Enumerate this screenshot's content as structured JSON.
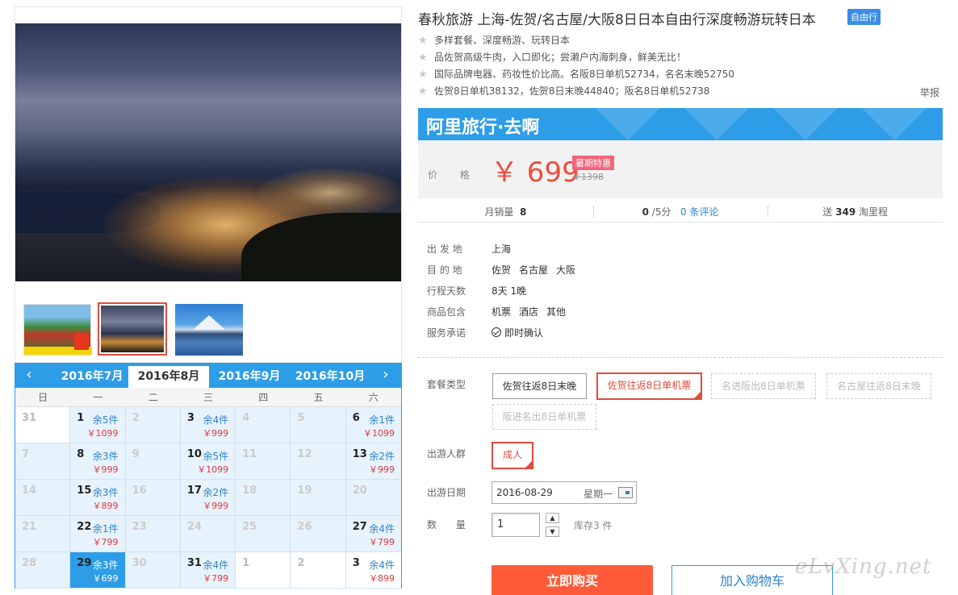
{
  "product": {
    "title": "春秋旅游 上海-佐贺/名古屋/大阪8日日本自由行深度畅游玩转日本",
    "tag": "自由行",
    "features": [
      "多样套餐、深度畅游、玩转日本",
      "品佐贺高级牛肉，入口即化；尝濑户内海刺身，鲜美无比！",
      "国际品牌电器、药妆性价比高。名阪8日单机52734，名名末晚52750",
      "佐贺8日单机38132，佐贺8日末晚44840；阪名8日单机52738"
    ],
    "report": "举报"
  },
  "price_box": {
    "brand": "阿里旅行·去啊",
    "price_label": "价 格",
    "price": "￥ 699",
    "promo": "暑期特惠",
    "original_price": "￥1398"
  },
  "stats": {
    "sales_label": "月销量",
    "sales_value": "8",
    "rating_value": "0",
    "rating_suffix": "/5分",
    "reviews_link": "0 条评论",
    "points_prefix": "送",
    "points_value": "349",
    "points_suffix": "淘里程"
  },
  "info": [
    {
      "key": "出 发 地",
      "values": [
        "上海"
      ]
    },
    {
      "key": "目 的 地",
      "values": [
        "佐贺",
        "名古屋",
        "大阪"
      ]
    },
    {
      "key": "行程天数",
      "values": [
        "8天 1晚"
      ]
    },
    {
      "key": "商品包含",
      "values": [
        "机票",
        "酒店",
        "其他"
      ]
    },
    {
      "key": "服务承诺",
      "values": [
        "即时确认"
      ]
    }
  ],
  "options": {
    "package_label": "套餐类型",
    "packages": [
      "佐贺往返8日末晚",
      "佐贺往返8日单机票",
      "名进阪出8日单机票",
      "名古屋往返8日末晚",
      "阪进名出8日单机票"
    ],
    "traveler_label": "出游人群",
    "traveler": "成人",
    "date_label": "出游日期",
    "date_value": "2016-08-29",
    "weekday": "星期一",
    "qty_label": "数 量",
    "qty_value": "1",
    "stock_text": "库存3 件"
  },
  "buttons": {
    "buy": "立即购买",
    "cart": "加入购物车"
  },
  "calendar": {
    "tabs": [
      "2016年7月",
      "2016年8月",
      "2016年9月",
      "2016年10月"
    ],
    "active_tab": "2016年8月",
    "weekdays": [
      "日",
      "一",
      "二",
      "三",
      "四",
      "五",
      "六"
    ],
    "cells": [
      {
        "d": "31",
        "out": true
      },
      {
        "d": "1",
        "s": "余5件",
        "p": "￥1099"
      },
      {
        "d": "2"
      },
      {
        "d": "3",
        "s": "余4件",
        "p": "￥999"
      },
      {
        "d": "4"
      },
      {
        "d": "5"
      },
      {
        "d": "6",
        "s": "余1件",
        "p": "￥1099"
      },
      {
        "d": "7"
      },
      {
        "d": "8",
        "s": "余3件",
        "p": "￥999"
      },
      {
        "d": "9"
      },
      {
        "d": "10",
        "s": "余5件",
        "p": "￥1099"
      },
      {
        "d": "11"
      },
      {
        "d": "12"
      },
      {
        "d": "13",
        "s": "余2件",
        "p": "￥999"
      },
      {
        "d": "14"
      },
      {
        "d": "15",
        "s": "余3件",
        "p": "￥899"
      },
      {
        "d": "16"
      },
      {
        "d": "17",
        "s": "余2件",
        "p": "￥999"
      },
      {
        "d": "18"
      },
      {
        "d": "19"
      },
      {
        "d": "20"
      },
      {
        "d": "21"
      },
      {
        "d": "22",
        "s": "余1件",
        "p": "￥799"
      },
      {
        "d": "23"
      },
      {
        "d": "24"
      },
      {
        "d": "25"
      },
      {
        "d": "26"
      },
      {
        "d": "27",
        "s": "余4件",
        "p": "￥799"
      },
      {
        "d": "28"
      },
      {
        "d": "29",
        "s": "余3件",
        "p": "￥699",
        "sel": true
      },
      {
        "d": "30"
      },
      {
        "d": "31",
        "s": "余4件",
        "p": "￥799"
      },
      {
        "d": "1",
        "out": true
      },
      {
        "d": "2",
        "out": true
      },
      {
        "d": "3",
        "s": "余4件",
        "p": "￥899",
        "out": true
      }
    ]
  },
  "watermark": "eLvXing.net",
  "colors": {
    "accent": "#2d9de8",
    "price": "#f04b3b",
    "buy": "#ff5b38"
  }
}
